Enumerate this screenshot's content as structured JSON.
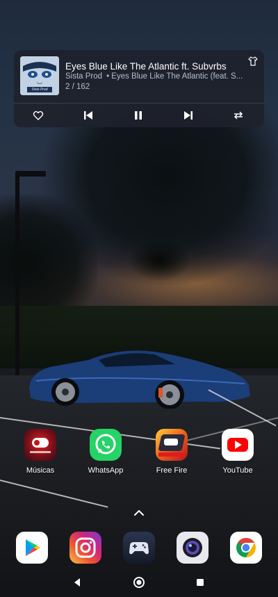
{
  "music_widget": {
    "title": "Eyes Blue Like The Atlantic  ft. Subvrbs",
    "artist": "Sista Prod",
    "album": "• Eyes Blue Like The Atlantic (feat. S...",
    "track_position": "2 / 162",
    "album_art_caption": "Sista Prod",
    "controls": [
      "heart-icon",
      "previous-icon",
      "pause-icon",
      "next-icon",
      "repeat-icon"
    ]
  },
  "home_apps": [
    {
      "label": "Músicas",
      "icon": "musicas-icon"
    },
    {
      "label": "WhatsApp",
      "icon": "whatsapp-icon"
    },
    {
      "label": "Free Fire",
      "icon": "free-fire-icon"
    },
    {
      "label": "YouTube",
      "icon": "youtube-icon"
    }
  ],
  "dock_apps": [
    {
      "icon": "play-store-icon"
    },
    {
      "icon": "instagram-icon"
    },
    {
      "icon": "game-launcher-icon"
    },
    {
      "icon": "camera-icon"
    },
    {
      "icon": "chrome-icon"
    }
  ],
  "navigation": [
    "back-icon",
    "home-icon",
    "recents-icon"
  ],
  "colors": {
    "card_bg": "#1e222c",
    "whatsapp": "#25d366",
    "youtube": "#ff0000",
    "instagram": "#c13584"
  }
}
